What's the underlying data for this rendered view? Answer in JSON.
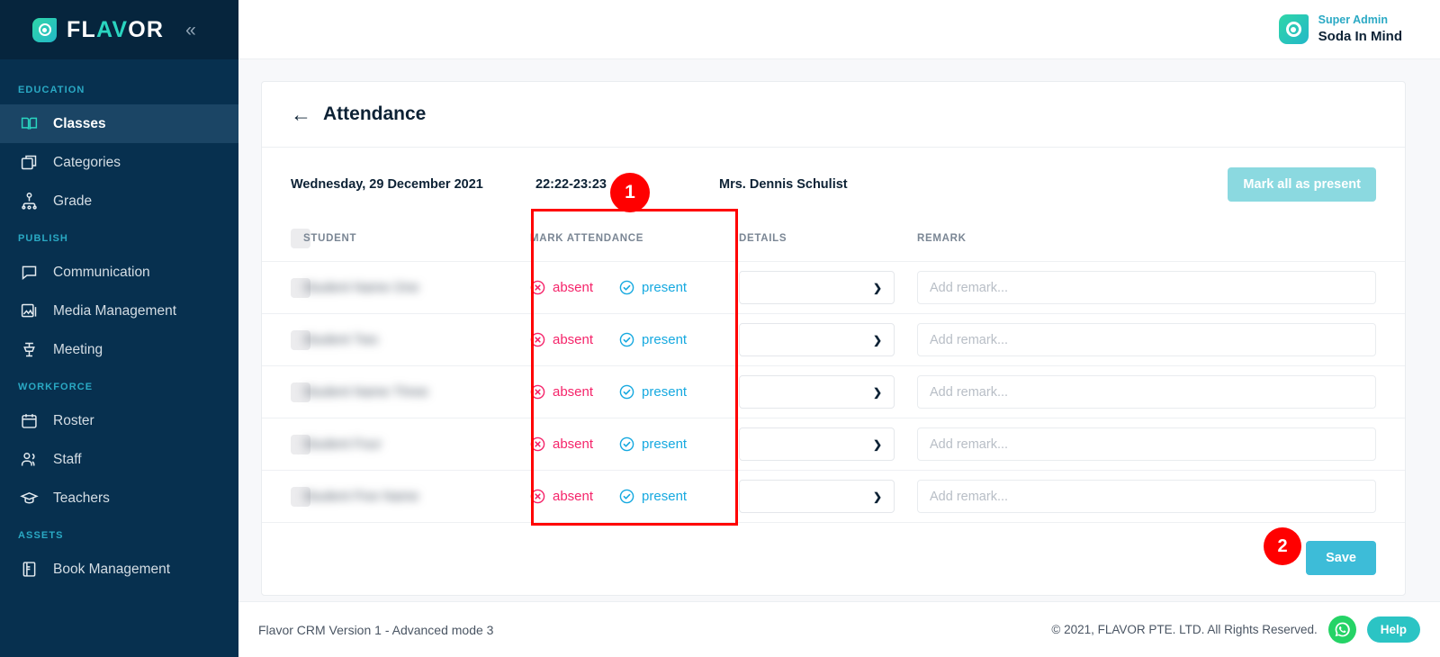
{
  "brand": {
    "name_part1": "FL",
    "name_part2": "AV",
    "name_part3": "OR",
    "collapse_icon": "chevron-double-left",
    "accent_teal": "#2ad5c0",
    "accent_blue": "#16a9e0",
    "accent_red": "#f5246a"
  },
  "topbar": {
    "user_role": "Super Admin",
    "user_name": "Soda In Mind"
  },
  "sidebar": {
    "sections": [
      {
        "label": "EDUCATION",
        "items": [
          {
            "label": "Classes",
            "icon": "book-open-icon",
            "active": true
          },
          {
            "label": "Categories",
            "icon": "boxes-icon",
            "active": false
          },
          {
            "label": "Grade",
            "icon": "hierarchy-icon",
            "active": false
          }
        ]
      },
      {
        "label": "PUBLISH",
        "items": [
          {
            "label": "Communication",
            "icon": "chat-bubble-icon",
            "active": false
          },
          {
            "label": "Media Management",
            "icon": "image-stack-icon",
            "active": false
          },
          {
            "label": "Meeting",
            "icon": "podium-icon",
            "active": false
          }
        ]
      },
      {
        "label": "WORKFORCE",
        "items": [
          {
            "label": "Roster",
            "icon": "calendar-icon",
            "active": false
          },
          {
            "label": "Staff",
            "icon": "users-icon",
            "active": false
          },
          {
            "label": "Teachers",
            "icon": "graduation-cap-icon",
            "active": false
          }
        ]
      },
      {
        "label": "ASSETS",
        "items": [
          {
            "label": "Book Management",
            "icon": "book-icon",
            "active": false
          }
        ]
      }
    ]
  },
  "page": {
    "title": "Attendance",
    "back_icon": "arrow-left-icon",
    "date": "Wednesday, 29 December 2021",
    "time_range": "22:22-23:23",
    "teacher": "Mrs. Dennis Schulist",
    "mark_all_label": "Mark all as present",
    "save_label": "Save"
  },
  "table": {
    "headers": [
      "STUDENT",
      "MARK ATTENDANCE",
      "DETAILS",
      "REMARK"
    ],
    "absent_label": "absent",
    "present_label": "present",
    "absent_icon": "circle-x-icon",
    "present_icon": "circle-check-icon",
    "details_placeholder": "",
    "details_chevron": "chevron-down-icon",
    "remark_placeholder": "Add remark...",
    "rows": [
      {
        "student": "",
        "details": "",
        "remark": ""
      },
      {
        "student": "",
        "details": "",
        "remark": ""
      },
      {
        "student": "",
        "details": "",
        "remark": ""
      },
      {
        "student": "",
        "details": "",
        "remark": ""
      },
      {
        "student": "",
        "details": "",
        "remark": ""
      }
    ]
  },
  "footer": {
    "version": "Flavor CRM Version 1 - Advanced mode 3",
    "copyright": "© 2021, FLAVOR PTE. LTD. All Rights Reserved.",
    "whatsapp_icon": "whatsapp-icon",
    "help_label": "Help"
  },
  "annotations": [
    {
      "number": "1",
      "target": "mark-attendance-column"
    },
    {
      "number": "2",
      "target": "save-button"
    }
  ]
}
